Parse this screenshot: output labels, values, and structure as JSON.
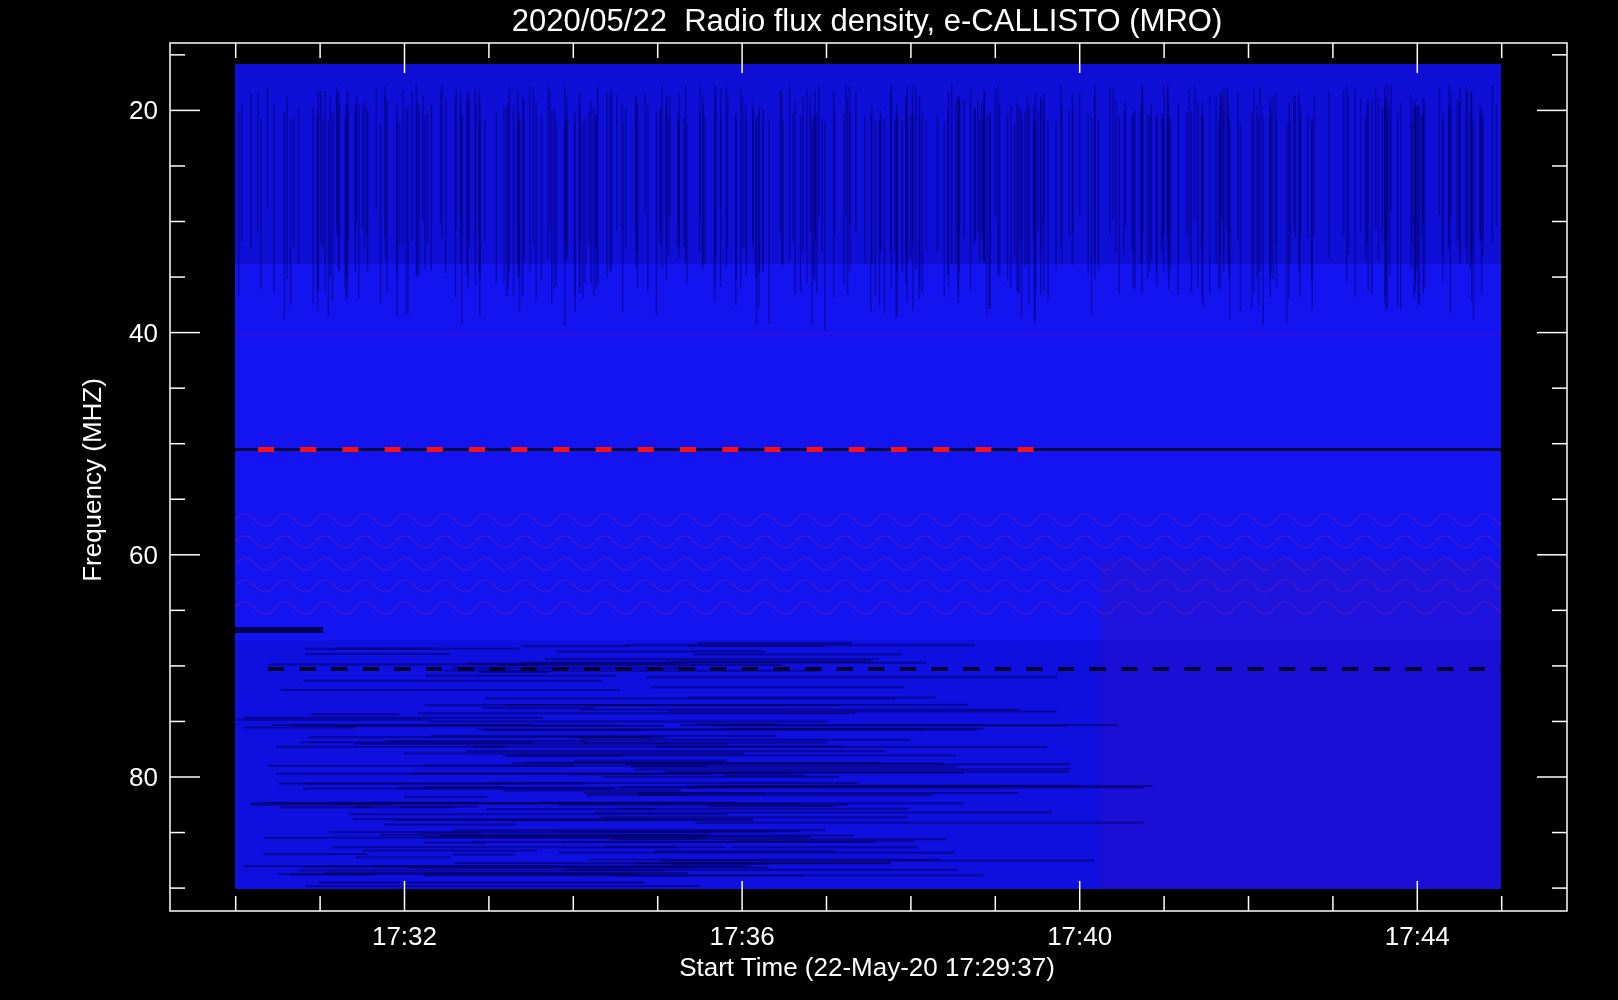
{
  "plot": {
    "title": "2020/05/22  Radio flux density, e-CALLISTO (MRO)",
    "ylabel": "Frequency (MHZ)",
    "xlabel": "Start Time (22-May-20 17:29:37)",
    "yticks": [
      "20",
      "40",
      "60",
      "80"
    ],
    "xticks": [
      "17:32",
      "17:36",
      "17:40",
      "17:44"
    ]
  }
}
